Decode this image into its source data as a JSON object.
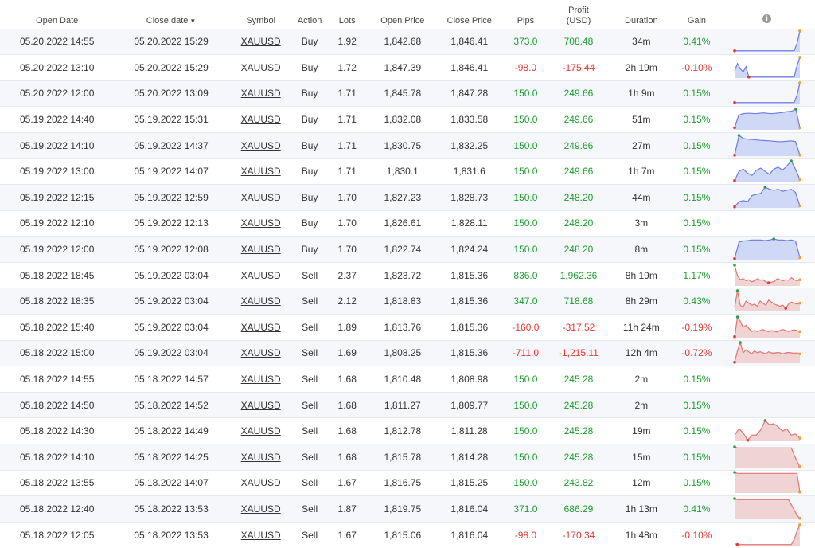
{
  "headers": {
    "open_date": "Open Date",
    "close_date": "Close date",
    "close_date_sort": "▼",
    "symbol": "Symbol",
    "action": "Action",
    "lots": "Lots",
    "open_price": "Open Price",
    "close_price": "Close Price",
    "pips": "Pips",
    "profit_line1": "Profit",
    "profit_line2": "(USD)",
    "duration": "Duration",
    "gain": "Gain",
    "info": "i"
  },
  "colors": {
    "positive": "#1a9e2c",
    "negative": "#e53935",
    "buy_line": "#6d7be6",
    "buy_fill": "#cfd8f7",
    "sell_line": "#e57373",
    "sell_fill": "#f0d4d4",
    "max_dot": "#2e9e44",
    "min_dot": "#e53935",
    "end_dot": "#f0a040"
  },
  "rows": [
    {
      "open_date": "05.20.2022 14:55",
      "close_date": "05.20.2022 15:29",
      "symbol": "XAUUSD",
      "action": "Buy",
      "lots": "1.92",
      "open_price": "1,842.68",
      "close_price": "1,846.41",
      "pips": "373.0",
      "profit": "708.48",
      "duration": "34m",
      "gain": "0.41%",
      "positive": true,
      "spark": [
        0.05,
        0.05,
        0.05,
        0.05,
        0.05,
        0.05,
        0.05,
        0.05,
        0.05,
        0.05,
        0.05,
        0.05,
        0.05,
        0.05,
        0.05,
        0.05,
        0.05,
        0.05,
        0.05,
        0.05,
        0.05,
        0.05,
        0.4,
        1.0
      ]
    },
    {
      "open_date": "05.20.2022 13:10",
      "close_date": "05.20.2022 15:29",
      "symbol": "XAUUSD",
      "action": "Buy",
      "lots": "1.72",
      "open_price": "1,847.39",
      "close_price": "1,846.41",
      "pips": "-98.0",
      "profit": "-175.44",
      "duration": "2h 19m",
      "gain": "-0.10%",
      "positive": false,
      "spark": [
        0.35,
        0.7,
        0.45,
        0.3,
        0.55,
        0.05,
        0.05,
        0.05,
        0.05,
        0.05,
        0.05,
        0.05,
        0.05,
        0.05,
        0.05,
        0.05,
        0.05,
        0.05,
        0.05,
        0.05,
        0.05,
        0.05,
        0.6,
        1.0
      ]
    },
    {
      "open_date": "05.20.2022 12:00",
      "close_date": "05.20.2022 13:09",
      "symbol": "XAUUSD",
      "action": "Buy",
      "lots": "1.71",
      "open_price": "1,845.78",
      "close_price": "1,847.28",
      "pips": "150.0",
      "profit": "249.66",
      "duration": "1h 9m",
      "gain": "0.15%",
      "positive": true,
      "spark": [
        0.05,
        0.05,
        0.05,
        0.05,
        0.05,
        0.05,
        0.05,
        0.05,
        0.05,
        0.05,
        0.05,
        0.05,
        0.05,
        0.05,
        0.05,
        0.05,
        0.05,
        0.05,
        0.05,
        0.05,
        0.05,
        0.05,
        0.4,
        1.0
      ]
    },
    {
      "open_date": "05.19.2022 14:40",
      "close_date": "05.19.2022 15:31",
      "symbol": "XAUUSD",
      "action": "Buy",
      "lots": "1.71",
      "open_price": "1,832.08",
      "close_price": "1,833.58",
      "pips": "150.0",
      "profit": "249.66",
      "duration": "51m",
      "gain": "0.15%",
      "positive": true,
      "spark": [
        0.1,
        0.7,
        0.78,
        0.8,
        0.8,
        0.78,
        0.8,
        0.82,
        0.8,
        0.78,
        0.8,
        0.82,
        0.85,
        0.88,
        0.9,
        1.0,
        0.1
      ]
    },
    {
      "open_date": "05.19.2022 14:10",
      "close_date": "05.19.2022 14:37",
      "symbol": "XAUUSD",
      "action": "Buy",
      "lots": "1.71",
      "open_price": "1,830.75",
      "close_price": "1,832.25",
      "pips": "150.0",
      "profit": "249.66",
      "duration": "27m",
      "gain": "0.15%",
      "positive": true,
      "spark": [
        0.05,
        1.0,
        0.85,
        0.82,
        0.8,
        0.78,
        0.76,
        0.75,
        0.74,
        0.72,
        0.7,
        0.7,
        0.72,
        0.74,
        0.7,
        0.05
      ]
    },
    {
      "open_date": "05.19.2022 13:00",
      "close_date": "05.19.2022 14:07",
      "symbol": "XAUUSD",
      "action": "Buy",
      "lots": "1.71",
      "open_price": "1,830.1",
      "close_price": "1,831.6",
      "pips": "150.0",
      "profit": "249.66",
      "duration": "1h 7m",
      "gain": "0.15%",
      "positive": true,
      "spark": [
        0.05,
        0.5,
        0.6,
        0.4,
        0.3,
        0.55,
        0.65,
        0.5,
        0.35,
        0.6,
        0.7,
        0.55,
        0.75,
        1.0,
        0.6,
        0.1
      ]
    },
    {
      "open_date": "05.19.2022 12:15",
      "close_date": "05.19.2022 12:59",
      "symbol": "XAUUSD",
      "action": "Buy",
      "lots": "1.70",
      "open_price": "1,827.23",
      "close_price": "1,828.73",
      "pips": "150.0",
      "profit": "248.20",
      "duration": "44m",
      "gain": "0.15%",
      "positive": true,
      "spark": [
        0.05,
        0.3,
        0.35,
        0.3,
        0.6,
        0.65,
        0.7,
        1.0,
        0.9,
        0.85,
        0.9,
        0.8,
        0.85,
        0.9,
        0.75,
        0.1
      ]
    },
    {
      "open_date": "05.19.2022 12:10",
      "close_date": "05.19.2022 12:13",
      "symbol": "XAUUSD",
      "action": "Buy",
      "lots": "1.70",
      "open_price": "1,826.61",
      "close_price": "1,828.11",
      "pips": "150.0",
      "profit": "248.20",
      "duration": "3m",
      "gain": "0.15%",
      "positive": true,
      "spark": []
    },
    {
      "open_date": "05.19.2022 12:00",
      "close_date": "05.19.2022 12:08",
      "symbol": "XAUUSD",
      "action": "Buy",
      "lots": "1.70",
      "open_price": "1,822.74",
      "close_price": "1,824.24",
      "pips": "150.0",
      "profit": "248.20",
      "duration": "8m",
      "gain": "0.15%",
      "positive": true,
      "spark": [
        0.05,
        0.85,
        0.9,
        0.92,
        0.95,
        0.95,
        0.95,
        0.92,
        0.95,
        1.0,
        0.95,
        0.95,
        0.92,
        0.95,
        0.9,
        0.1
      ]
    },
    {
      "open_date": "05.18.2022 18:45",
      "close_date": "05.19.2022 03:04",
      "symbol": "XAUUSD",
      "action": "Sell",
      "lots": "2.37",
      "open_price": "1,823.72",
      "close_price": "1,815.36",
      "pips": "836.0",
      "profit": "1,962.36",
      "duration": "8h 19m",
      "gain": "1.17%",
      "positive": true,
      "spark": [
        1.0,
        0.5,
        0.3,
        0.35,
        0.25,
        0.3,
        0.2,
        0.25,
        0.35,
        0.28,
        0.3,
        0.2,
        0.15,
        0.18,
        0.22,
        0.35,
        0.3,
        0.25,
        0.3,
        0.28,
        0.4,
        0.3,
        0.25,
        0.3
      ]
    },
    {
      "open_date": "05.18.2022 18:35",
      "close_date": "05.19.2022 03:04",
      "symbol": "XAUUSD",
      "action": "Sell",
      "lots": "2.12",
      "open_price": "1,818.83",
      "close_price": "1,815.36",
      "pips": "347.0",
      "profit": "718.68",
      "duration": "8h 29m",
      "gain": "0.43%",
      "positive": true,
      "spark": [
        0.2,
        1.0,
        0.3,
        0.2,
        0.5,
        0.4,
        0.3,
        0.35,
        0.25,
        0.5,
        0.4,
        0.3,
        0.55,
        0.45,
        0.35,
        0.3,
        0.25,
        0.3,
        0.15,
        0.35,
        0.45,
        0.4,
        0.35,
        0.4
      ]
    },
    {
      "open_date": "05.18.2022 15:40",
      "close_date": "05.19.2022 03:04",
      "symbol": "XAUUSD",
      "action": "Sell",
      "lots": "1.89",
      "open_price": "1,813.76",
      "close_price": "1,815.36",
      "pips": "-160.0",
      "profit": "-317.52",
      "duration": "11h 24m",
      "gain": "-0.19%",
      "positive": false,
      "spark": [
        0.05,
        1.0,
        0.8,
        0.5,
        0.6,
        0.45,
        0.3,
        0.35,
        0.3,
        0.35,
        0.4,
        0.32,
        0.3,
        0.35,
        0.3,
        0.28,
        0.35,
        0.4,
        0.35,
        0.3,
        0.35,
        0.38,
        0.35,
        0.3
      ]
    },
    {
      "open_date": "05.18.2022 15:00",
      "close_date": "05.19.2022 03:04",
      "symbol": "XAUUSD",
      "action": "Sell",
      "lots": "1.69",
      "open_price": "1,808.25",
      "close_price": "1,815.36",
      "pips": "-711.0",
      "profit": "-1,215.11",
      "duration": "12h 4m",
      "gain": "-0.72%",
      "positive": false,
      "spark": [
        0.05,
        0.6,
        1.0,
        0.5,
        0.65,
        0.55,
        0.45,
        0.6,
        0.5,
        0.55,
        0.5,
        0.45,
        0.55,
        0.5,
        0.48,
        0.52,
        0.5,
        0.45,
        0.5,
        0.52,
        0.5,
        0.48,
        0.5,
        0.45
      ]
    },
    {
      "open_date": "05.18.2022 14:55",
      "close_date": "05.18.2022 14:57",
      "symbol": "XAUUSD",
      "action": "Sell",
      "lots": "1.68",
      "open_price": "1,810.48",
      "close_price": "1,808.98",
      "pips": "150.0",
      "profit": "245.28",
      "duration": "2m",
      "gain": "0.15%",
      "positive": true,
      "spark": []
    },
    {
      "open_date": "05.18.2022 14:50",
      "close_date": "05.18.2022 14:52",
      "symbol": "XAUUSD",
      "action": "Sell",
      "lots": "1.68",
      "open_price": "1,811.27",
      "close_price": "1,809.77",
      "pips": "150.0",
      "profit": "245.28",
      "duration": "2m",
      "gain": "0.15%",
      "positive": true,
      "spark": []
    },
    {
      "open_date": "05.18.2022 14:30",
      "close_date": "05.18.2022 14:49",
      "symbol": "XAUUSD",
      "action": "Sell",
      "lots": "1.68",
      "open_price": "1,812.78",
      "close_price": "1,811.28",
      "pips": "150.0",
      "profit": "245.28",
      "duration": "19m",
      "gain": "0.15%",
      "positive": true,
      "spark": [
        0.3,
        0.6,
        0.4,
        0.05,
        0.3,
        0.3,
        0.55,
        1.0,
        0.8,
        0.85,
        0.7,
        0.5,
        0.6,
        0.3,
        0.35,
        0.15
      ]
    },
    {
      "open_date": "05.18.2022 14:10",
      "close_date": "05.18.2022 14:25",
      "symbol": "XAUUSD",
      "action": "Sell",
      "lots": "1.68",
      "open_price": "1,815.78",
      "close_price": "1,814.28",
      "pips": "150.0",
      "profit": "245.28",
      "duration": "15m",
      "gain": "0.15%",
      "positive": true,
      "spark": [
        1.0,
        0.95,
        0.95,
        0.95,
        0.95,
        0.95,
        0.95,
        0.95,
        0.95,
        0.95,
        0.95,
        0.95,
        0.95,
        0.95,
        0.95,
        0.95,
        0.95,
        0.95,
        0.95,
        0.95,
        0.95,
        0.6,
        0.3,
        0.05
      ]
    },
    {
      "open_date": "05.18.2022 13:55",
      "close_date": "05.18.2022 14:07",
      "symbol": "XAUUSD",
      "action": "Sell",
      "lots": "1.67",
      "open_price": "1,816.75",
      "close_price": "1,815.25",
      "pips": "150.0",
      "profit": "243.82",
      "duration": "12m",
      "gain": "0.15%",
      "positive": true,
      "spark": [
        1.0,
        0.95,
        0.95,
        0.95,
        0.95,
        0.95,
        0.95,
        0.95,
        0.95,
        0.95,
        0.95,
        0.95,
        0.95,
        0.95,
        0.95,
        0.95,
        0.95,
        0.95,
        0.95,
        0.95,
        0.95,
        0.95,
        0.95,
        0.05
      ]
    },
    {
      "open_date": "05.18.2022 12:40",
      "close_date": "05.18.2022 13:53",
      "symbol": "XAUUSD",
      "action": "Sell",
      "lots": "1.87",
      "open_price": "1,819.75",
      "close_price": "1,816.04",
      "pips": "371.0",
      "profit": "686.29",
      "duration": "1h 13m",
      "gain": "0.41%",
      "positive": true,
      "spark": [
        1.0,
        0.95,
        0.95,
        0.95,
        0.95,
        0.95,
        0.95,
        0.95,
        0.95,
        0.95,
        0.95,
        0.95,
        0.95,
        0.95,
        0.95,
        0.95,
        0.95,
        0.95,
        0.95,
        0.95,
        0.7,
        0.45,
        0.2,
        0.05
      ]
    },
    {
      "open_date": "05.18.2022 12:05",
      "close_date": "05.18.2022 13:53",
      "symbol": "XAUUSD",
      "action": "Sell",
      "lots": "1.67",
      "open_price": "1,815.06",
      "close_price": "1,816.04",
      "pips": "-98.0",
      "profit": "-170.34",
      "duration": "1h 48m",
      "gain": "-0.10%",
      "positive": false,
      "spark": [
        0.1,
        0.05,
        0.05,
        0.05,
        0.05,
        0.05,
        0.05,
        0.05,
        0.05,
        0.05,
        0.05,
        0.05,
        0.05,
        0.05,
        0.05,
        0.05,
        0.05,
        0.05,
        0.05,
        0.05,
        0.05,
        0.3,
        0.7,
        1.0
      ]
    }
  ]
}
